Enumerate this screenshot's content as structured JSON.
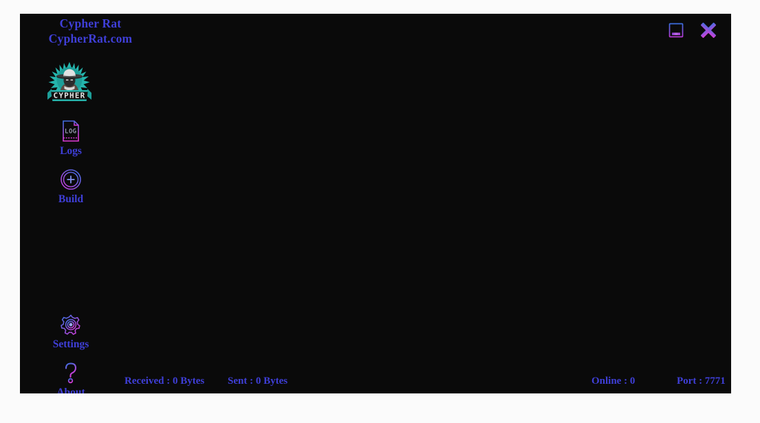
{
  "window": {
    "brand_line_1": "Cypher Rat",
    "brand_line_2": "CypherRat.com",
    "background_color": "#0a0a0a",
    "accent_text_color": "#3f3fd8",
    "gradient_start": "#3b6fe0",
    "gradient_end": "#d63ad6",
    "logo_color": "#27b8b0"
  },
  "title_bar": {
    "minimize_label": "Minimize",
    "minimize_icon": "minimize-icon",
    "close_label": "Close",
    "close_icon": "close-x-icon"
  },
  "sidebar": {
    "logo_name": "cypher-rat-logo",
    "logo_banner_text": "CYPHER",
    "items": [
      {
        "id": "logs",
        "label": "Logs",
        "icon": "log-document-icon",
        "icon_text": "LOG"
      },
      {
        "id": "build",
        "label": "Build",
        "icon": "plus-circle-icon",
        "icon_text": "+"
      },
      {
        "id": "settings",
        "label": "Settings",
        "icon": "gear-icon",
        "icon_text": ""
      },
      {
        "id": "about",
        "label": "About",
        "icon": "question-mark-icon",
        "icon_text": "?"
      }
    ]
  },
  "main": {
    "content": ""
  },
  "status_bar": {
    "received": "Received : 0 Bytes",
    "sent": "Sent : 0 Bytes",
    "online": "Online : 0",
    "port": "Port : 7771"
  }
}
